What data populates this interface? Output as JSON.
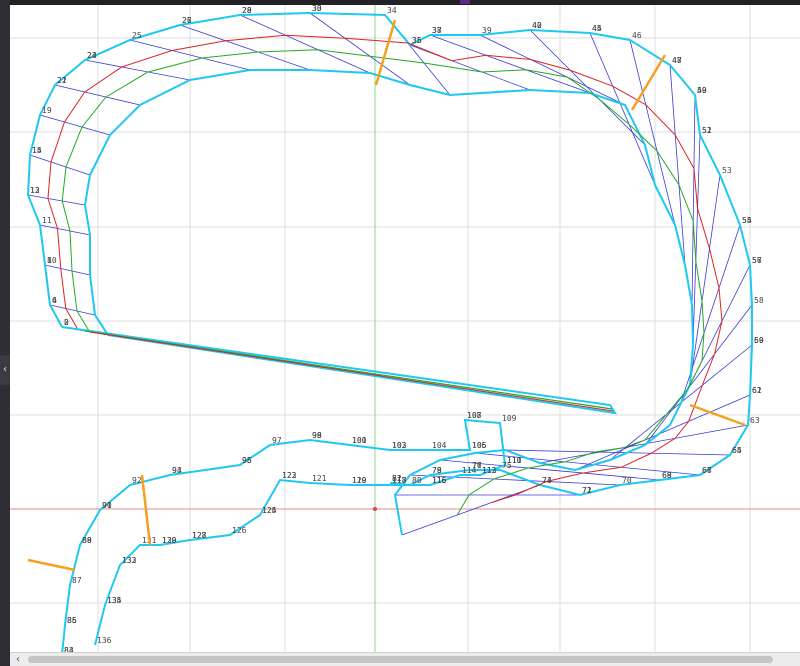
{
  "viewport": {
    "side_tab_glyph": "‹",
    "scroll_left_glyph": "‹"
  },
  "colors": {
    "boundary": "#1ec8f0",
    "sector": "#3a3ad8",
    "racing_line": "#dd2222",
    "center_line": "#22aa22",
    "grid": "#dddddd",
    "origin_x_axis": "#e88a8a",
    "origin_y_axis": "#8ad88a",
    "marker": "#f5a020"
  },
  "track": {
    "node_labels": [
      "0",
      "2",
      "4",
      "6",
      "8",
      "10",
      "11",
      "12",
      "13",
      "14",
      "15",
      "19",
      "21",
      "22",
      "23",
      "24",
      "25",
      "26",
      "27",
      "28",
      "29",
      "30",
      "33",
      "34",
      "35",
      "36",
      "37",
      "38",
      "39",
      "40",
      "42",
      "44",
      "45",
      "46",
      "47",
      "48",
      "49",
      "50",
      "51",
      "52",
      "53",
      "54",
      "55",
      "56",
      "57",
      "58",
      "59",
      "60",
      "61",
      "62",
      "63",
      "64",
      "65",
      "66",
      "67",
      "68",
      "69",
      "70",
      "71",
      "72",
      "73",
      "74",
      "75",
      "76",
      "77",
      "78",
      "79",
      "80",
      "81",
      "82",
      "83",
      "84",
      "85",
      "86",
      "87",
      "88",
      "89",
      "90",
      "91",
      "92",
      "93",
      "94",
      "95",
      "96",
      "97",
      "98",
      "99",
      "100",
      "101",
      "102",
      "103",
      "104",
      "105",
      "106",
      "107",
      "108",
      "109",
      "110",
      "111",
      "112",
      "113",
      "114",
      "115",
      "116",
      "117",
      "118",
      "119",
      "120",
      "121",
      "122",
      "123",
      "124",
      "125",
      "126",
      "127",
      "128",
      "129",
      "130",
      "131",
      "132",
      "133",
      "134",
      "135",
      "136"
    ]
  }
}
